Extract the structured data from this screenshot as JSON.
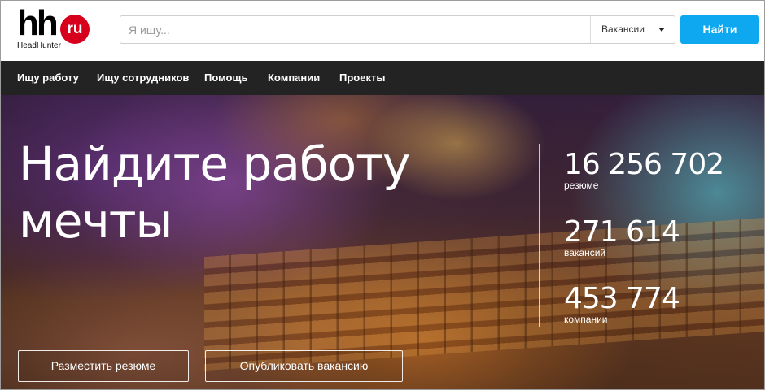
{
  "header": {
    "logo": {
      "mark": "hh",
      "badge": "ru",
      "subtitle": "HeadHunter"
    },
    "search": {
      "placeholder": "Я ищу...",
      "value": "",
      "category": "Вакансии"
    },
    "find_button": "Найти"
  },
  "nav": {
    "items": [
      "Ищу работу",
      "Ищу сотрудников",
      "Помощь",
      "Компании",
      "Проекты"
    ]
  },
  "hero": {
    "title_line1": "Найдите работу",
    "title_line2": "мечты",
    "stats": [
      {
        "value": "16 256 702",
        "label": "резюме"
      },
      {
        "value": "271 614",
        "label": "вакансий"
      },
      {
        "value": "453 774",
        "label": "компании"
      }
    ],
    "buttons": {
      "post_resume": "Разместить резюме",
      "post_vacancy": "Опубликовать вакансию"
    }
  },
  "colors": {
    "brand_red": "#d6001c",
    "accent_blue": "#0ea8f0",
    "nav_bg": "#232323"
  }
}
